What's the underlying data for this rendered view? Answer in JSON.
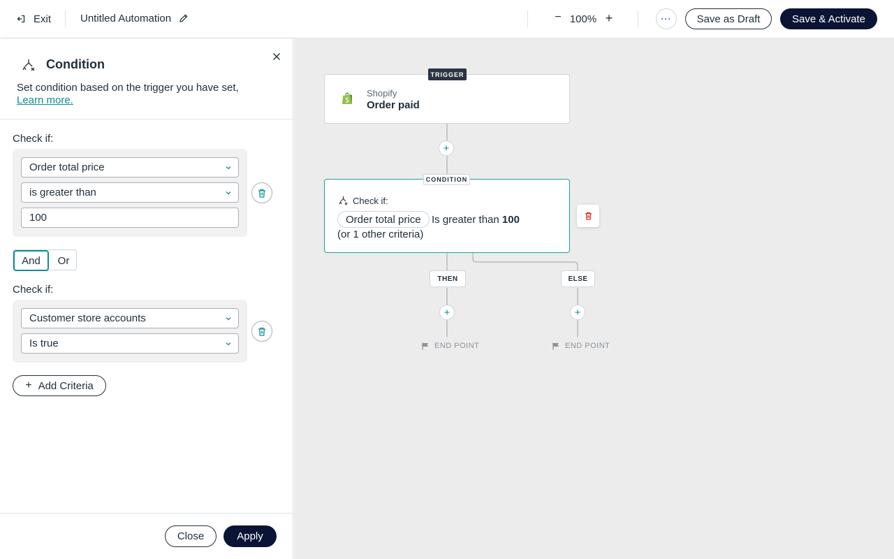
{
  "topbar": {
    "exit_label": "Exit",
    "automation_title": "Untitled Automation",
    "zoom_minus": "−",
    "zoom_level": "100%",
    "zoom_plus": "+",
    "more_label": "···",
    "save_draft_label": "Save as Draft",
    "save_activate_label": "Save & Activate"
  },
  "panel": {
    "title": "Condition",
    "description": "Set condition based on the trigger you have set,",
    "learn_more": "Learn more.",
    "criteria": [
      {
        "check_label": "Check if:",
        "field": "Order total price",
        "operator": "is greater than",
        "value": "100"
      },
      {
        "check_label": "Check if:",
        "field": "Customer store accounts",
        "operator": "Is true"
      }
    ],
    "logic": {
      "and_label": "And",
      "or_label": "Or",
      "selected": "And"
    },
    "add_criteria_label": "Add Criteria",
    "close_label": "Close",
    "apply_label": "Apply"
  },
  "canvas": {
    "trigger": {
      "badge": "TRIGGER",
      "app": "Shopify",
      "event": "Order paid"
    },
    "condition": {
      "badge": "CONDITION",
      "check_label": "Check if:",
      "pill": "Order total price",
      "operator_text": "Is greater than",
      "value": "100",
      "other": "(or 1 other criteria)"
    },
    "add_step": "+",
    "then_label": "THEN",
    "else_label": "ELSE",
    "endpoint_label": "END POINT"
  },
  "colors": {
    "accent_teal": "#0f8f93",
    "primary_dark": "#0b1435",
    "delete_red": "#e62214"
  }
}
